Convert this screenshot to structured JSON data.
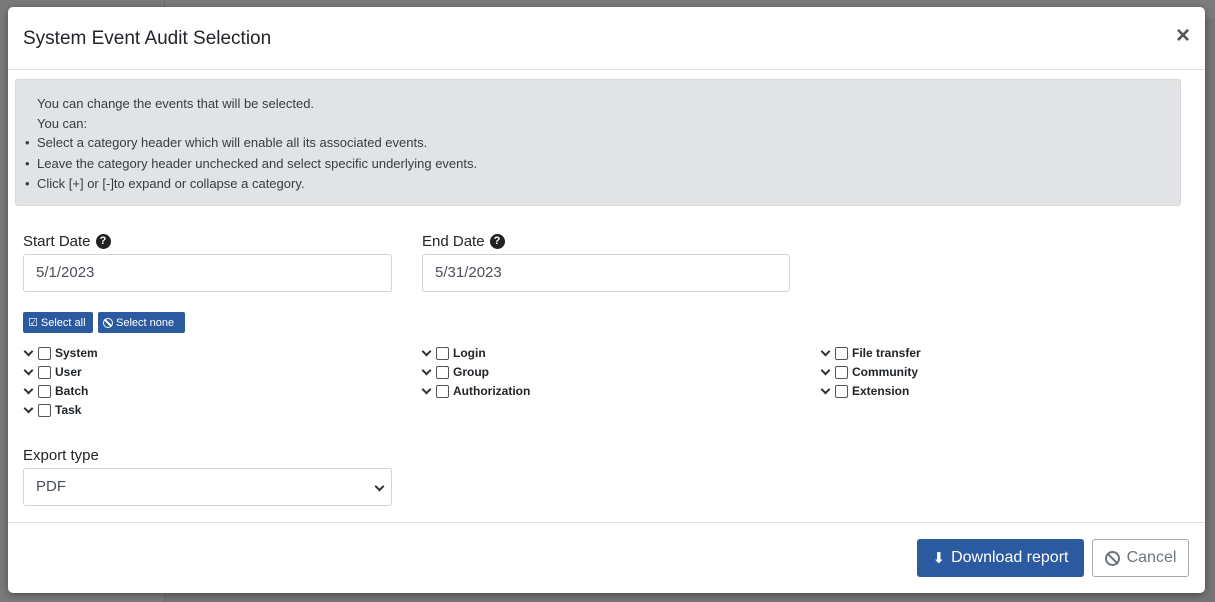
{
  "modal": {
    "title": "System Event Audit Selection",
    "close_label": "×"
  },
  "info": {
    "line1": "You can change the events that will be selected.",
    "line2": "You can:",
    "bullets": [
      "Select a category header which will enable all its associated events.",
      "Leave the category header unchecked and select specific underlying events.",
      "Click [+] or [-]to expand or collapse a category."
    ]
  },
  "start_date": {
    "label": "Start Date",
    "value": "5/1/2023"
  },
  "end_date": {
    "label": "End Date",
    "value": "5/31/2023"
  },
  "selection_buttons": {
    "select_all": "Select all",
    "select_none": "Select none"
  },
  "categories": {
    "col1": [
      "System",
      "User",
      "Batch",
      "Task"
    ],
    "col2": [
      "Login",
      "Group",
      "Authorization"
    ],
    "col3": [
      "File transfer",
      "Community",
      "Extension"
    ]
  },
  "export": {
    "label": "Export type",
    "value": "PDF"
  },
  "footer": {
    "download_label": "Download report",
    "cancel_label": "Cancel"
  },
  "colors": {
    "primary": "#2c5aa0",
    "info_bg": "#e2e3e5"
  }
}
